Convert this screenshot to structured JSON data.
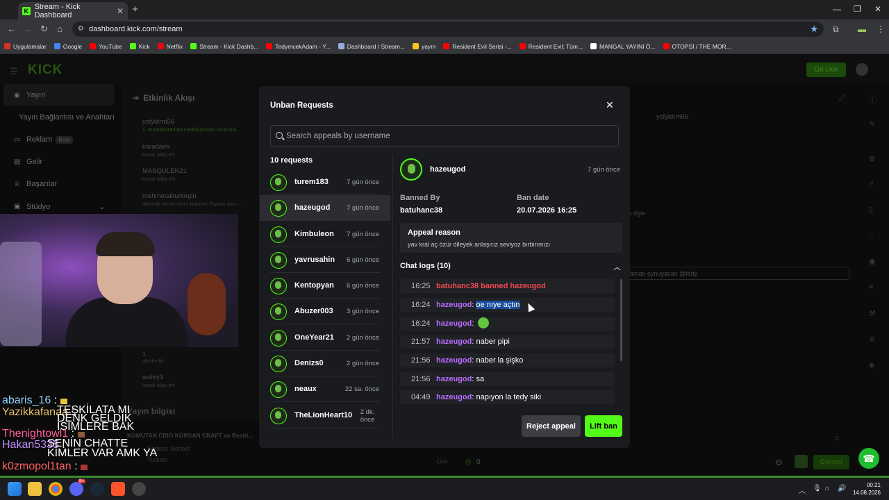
{
  "browser": {
    "tab_title": "Stream - Kick Dashboard",
    "url": "dashboard.kick.com/stream",
    "bookmarks": [
      {
        "label": "Uygulamalar",
        "color": "#d93025"
      },
      {
        "label": "Google",
        "color": "#4285f4"
      },
      {
        "label": "YouTube",
        "color": "#ff0000"
      },
      {
        "label": "Kick",
        "color": "#53fc18"
      },
      {
        "label": "Netflix",
        "color": "#e50914"
      },
      {
        "label": "Stream - Kick Dashb...",
        "color": "#53fc18"
      },
      {
        "label": "TedymcekAdam - Y...",
        "color": "#ff0000"
      },
      {
        "label": "Dashboard / Stream...",
        "color": "#9ad"
      },
      {
        "label": "yayın",
        "color": "#f5c518"
      },
      {
        "label": "Resident Evil Serisi -...",
        "color": "#ff0000"
      },
      {
        "label": "Resident Evil: Tüm...",
        "color": "#ff0000"
      },
      {
        "label": "MANGAL YAYINI Ö...",
        "color": "#ffffff"
      },
      {
        "label": "OTOPSİ / THE MOR...",
        "color": "#ff0000"
      }
    ]
  },
  "dashboard": {
    "logo": "KICK",
    "go_live": "Go Live",
    "sidebar": {
      "items": [
        {
          "label": "Yayın",
          "icon": "broadcast-icon"
        },
        {
          "label": "Yayın Bağlantısı ve Anahtarı",
          "icon": ""
        },
        {
          "label": "Reklam",
          "icon": "ad-icon",
          "badge": "Beta"
        },
        {
          "label": "Gelir",
          "icon": "wallet-icon"
        },
        {
          "label": "Başarılar",
          "icon": "trophy-icon"
        },
        {
          "label": "Stüdyo",
          "icon": "studio-icon"
        }
      ]
    },
    "activity": {
      "title": "Etkinlik Akışı",
      "items": [
        {
          "name": "ysfyldrm56",
          "sub": "1. NureddinMuhammedbinAhmed isimli kull..."
        },
        {
          "name": "karadaek",
          "sub": "kanalı takip etti"
        },
        {
          "name": "MASQULEN21",
          "sub": "kanalı takip etti"
        },
        {
          "name": "mehmetaliturkoglu",
          "sub": "abonelik yenilemesini kutluyor! Toplam abon..."
        },
        {
          "name": "woltry3",
          "sub": "kanalı takip etti"
        }
      ],
      "gift_count": "1",
      "gift_label": "gönderildi"
    },
    "stream_info": {
      "title": "Yayın bilgisi",
      "stream_title": "KOMUTAN CİBO KORSAN CRAFT ve Resid...",
      "category": "Sadece Sohbet",
      "language": "Turkish"
    },
    "chat_right": {
      "user": "ysfyldrm56",
      "snippet1": "s diye",
      "snippet2": "aman oynuyacan @tedy",
      "send": "Gönder",
      "viewer_count": "0"
    }
  },
  "overlay_chat": [
    {
      "name": "abaris_16",
      "color": "#8fd3ff",
      "msg": ""
    },
    {
      "name": "Yazikkafanaa",
      "color": "#e8c06a",
      "msg": "TEŞKİLATA MI DENK GELDİK İSİMLERE BAK"
    },
    {
      "name": "Thenightowl1",
      "color": "#ff5ea0",
      "msg": ""
    },
    {
      "name": "Hakan5335",
      "color": "#c28bff",
      "msg": "SENİN CHATTE KİMLER VAR AMK YA"
    },
    {
      "name": "k0zmopol1tan",
      "color": "#ff6060",
      "msg": ""
    }
  ],
  "modal": {
    "title": "Unban Requests",
    "search_placeholder": "Search appeals by username",
    "count_label": "10 requests",
    "requests": [
      {
        "name": "turem183",
        "time": "7 gün önce"
      },
      {
        "name": "hazeugod",
        "time": "7 gün önce",
        "selected": true
      },
      {
        "name": "Kimbuleon",
        "time": "7 gün önce"
      },
      {
        "name": "yavrusahin",
        "time": "6 gün önce"
      },
      {
        "name": "Kentopyan",
        "time": "6 gün önce"
      },
      {
        "name": "Abuzer003",
        "time": "3 gün önce"
      },
      {
        "name": "OneYear21",
        "time": "2 gün önce"
      },
      {
        "name": "Denizs0",
        "time": "2 gün önce"
      },
      {
        "name": "neaux",
        "time": "22 sa. önce"
      },
      {
        "name": "TheLionHeart10",
        "time": "2 dk. önce"
      }
    ],
    "detail": {
      "username": "hazeugod",
      "time": "7 gün önce",
      "banned_by_label": "Banned By",
      "banned_by": "batuhanc38",
      "ban_date_label": "Ban date",
      "ban_date": "20.07.2026 16:25",
      "appeal_title": "Appeal reason",
      "appeal_text": "yav kral aç özür dileyek anlaşırız seviyoz bırbirımızı",
      "logs_title": "Chat logs (10)",
      "logs": [
        {
          "time": "16:25",
          "ban_text": "batuhanc38 banned hazeugod"
        },
        {
          "time": "16:24",
          "user": "hazeugod",
          "msg": "oe nıye açtın",
          "highlight": true
        },
        {
          "time": "16:24",
          "user": "hazeugod",
          "msg": "",
          "emote": true
        },
        {
          "time": "21:57",
          "user": "hazeugod",
          "msg": "naber pipi"
        },
        {
          "time": "21:56",
          "user": "hazeugod",
          "msg": "naber la şişko"
        },
        {
          "time": "21:56",
          "user": "hazeugod",
          "msg": "sa"
        },
        {
          "time": "04:49",
          "user": "hazeugod",
          "msg": "napıyon la tedy siki"
        }
      ]
    },
    "reject_label": "Reject appeal",
    "lift_label": "Lift ban"
  },
  "taskbar": {
    "time": "00:21",
    "date": "14.08.2026",
    "discord_badge": "9+"
  }
}
